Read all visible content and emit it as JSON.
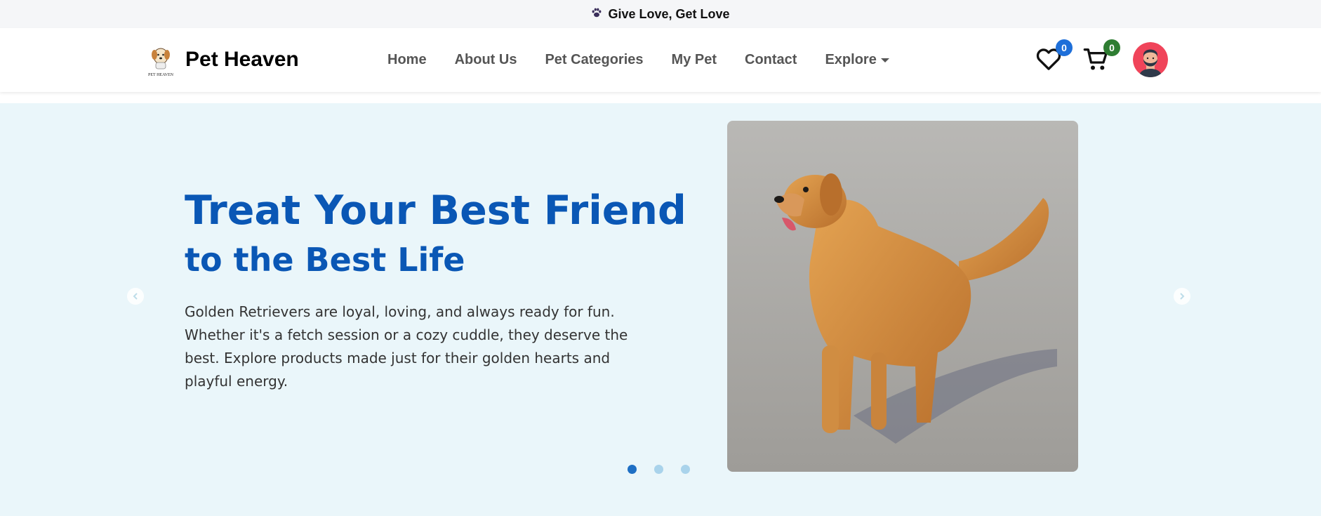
{
  "announcement": {
    "text": "Give Love, Get Love",
    "icon": "paw-icon"
  },
  "brand": {
    "name": "Pet Heaven",
    "logo_text": "PET HEAVEN"
  },
  "nav": {
    "items": [
      {
        "label": "Home"
      },
      {
        "label": "About Us"
      },
      {
        "label": "Pet Categories"
      },
      {
        "label": "My Pet"
      },
      {
        "label": "Contact"
      },
      {
        "label": "Explore"
      }
    ]
  },
  "header_icons": {
    "wishlist": {
      "icon": "heart-icon",
      "count": "0",
      "badge_color": "#1e6fd9"
    },
    "cart": {
      "icon": "cart-icon",
      "count": "0",
      "badge_color": "#2e7d32"
    }
  },
  "hero": {
    "headline_line1": "Treat Your Best Friend",
    "headline_line2": "to the Best Life",
    "description": "Golden Retrievers are loyal, loving, and always ready for fun. Whether it's a fetch session or a cozy cuddle, they deserve the best. Explore products made just for their golden hearts and playful energy.",
    "image": "golden-retriever-photo",
    "slides_count": 3,
    "active_slide": 1
  },
  "colors": {
    "accent": "#0a57b5",
    "hero_bg": "#eaf6fa"
  }
}
